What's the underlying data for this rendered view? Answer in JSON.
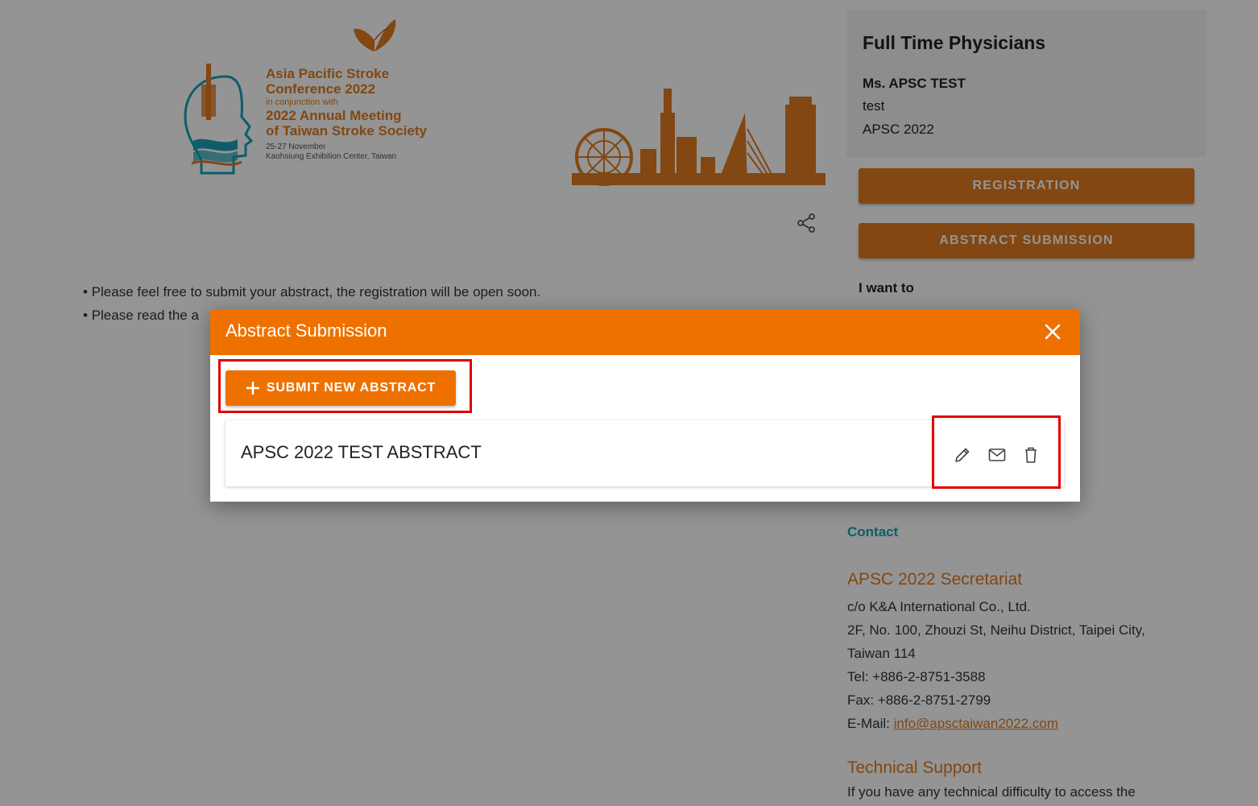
{
  "banner": {
    "conf_line1": "Asia Pacific Stroke",
    "conf_line2": "Conference 2022",
    "conf_small": "in conjunction with",
    "conf_line3": "2022 Annual Meeting",
    "conf_line4": "of Taiwan Stroke Society",
    "conf_date": "25-27 November",
    "conf_venue": "Kaohsiung Exhibition Center, Taiwan"
  },
  "notes": {
    "line1": "• Please feel free to submit your abstract, the registration will be open soon.",
    "line2": "• Please read the a"
  },
  "sidebar": {
    "title": "Full Time Physicians",
    "user_name": "Ms. APSC TEST",
    "user_line1": "test",
    "user_line2": "APSC 2022",
    "registration_label": "REGISTRATION",
    "abstract_label": "ABSTRACT SUBMISSION",
    "i_want_to": "I want to"
  },
  "contact": {
    "heading": "Contact",
    "secretariat_heading": "APSC 2022 Secretariat",
    "addr1": "c/o K&A International Co., Ltd.",
    "addr2": "2F, No. 100, Zhouzi St, Neihu District, Taipei City,",
    "addr3": "Taiwan 114",
    "tel": "Tel: +886-2-8751-3588",
    "fax": "Fax: +886-2-8751-2799",
    "email_label": "E-Mail: ",
    "email": "info@apsctaiwan2022.com",
    "tech_heading": "Technical Support",
    "tech_text": "If you have any technical difficulty to access the"
  },
  "modal": {
    "title": "Abstract Submission",
    "submit_label": "SUBMIT NEW ABSTRACT",
    "abstracts": [
      {
        "title": "APSC 2022 TEST ABSTRACT"
      }
    ]
  },
  "colors": {
    "brand_orange": "#ee7100",
    "accent_orange": "#e07a1f",
    "contact_teal": "#19a0b8",
    "highlight_red": "#e00000"
  },
  "icons": [
    "butterfly-logo",
    "head-logo",
    "skyline-illustration",
    "share-icon",
    "close-icon",
    "plus-icon",
    "edit-icon",
    "mail-icon",
    "delete-icon"
  ]
}
